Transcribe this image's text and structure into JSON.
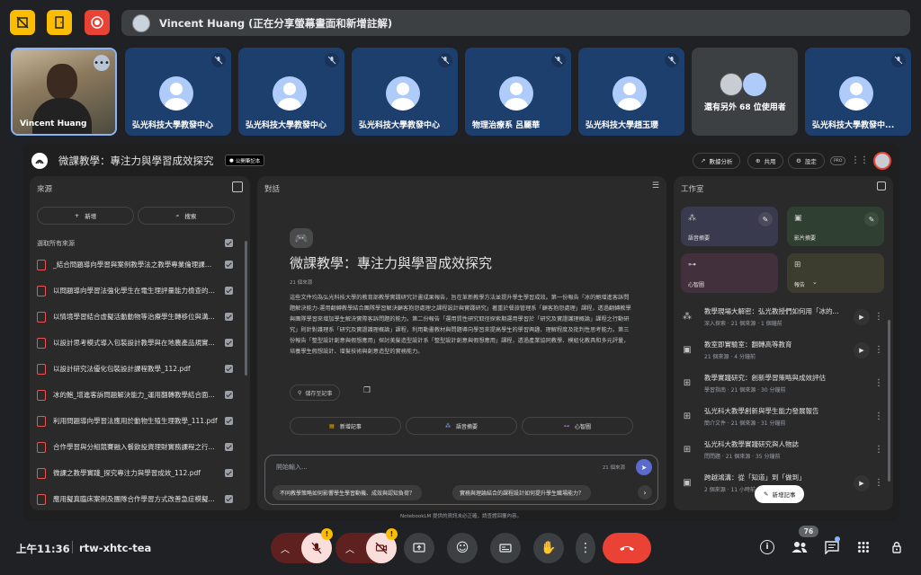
{
  "presenter_bar": {
    "text": "Vincent Huang (正在分享螢幕畫面和新增註解)"
  },
  "participants": [
    {
      "name": "Vincent Huang"
    },
    {
      "name": "弘光科技大學教發中心"
    },
    {
      "name": "弘光科技大學教發中心"
    },
    {
      "name": "弘光科技大學教發中心"
    },
    {
      "name": "物理治療系 呂麗華"
    },
    {
      "name": "弘光科技大學趙玉瓔"
    },
    {
      "name": "還有另外 68 位使用者"
    },
    {
      "name": "弘光科技大學教發中..."
    }
  ],
  "notebook": {
    "title": "微課教學：專注力與學習成效探究",
    "public_badge": "公開筆記本",
    "header_buttons": {
      "analytics": "數據分析",
      "share": "共用",
      "settings": "設定",
      "pro": "PRO"
    },
    "sources": {
      "title": "來源",
      "add": "新增",
      "search": "搜索",
      "select_all": "選取所有來源",
      "items": [
        "_結合問題導向學習與案例教學法之教學專業倫理課程...",
        "以問題導向學習法強化學生在電生理評量能力檢查的問題...",
        "以情境學習結合虛擬活動動物等治療學生轉移位與溝...",
        "以設計思考模式導入包裝設計教學與在地農產品規實...",
        "以設計研究法優化包裝設計課程教學_112.pdf",
        "冰的鮑_增進客訴問題解決能力_運用翻轉教學結合面...",
        "利用問題導向學習法應用於動物生殖生理教學_111.pdf",
        "合作學習與分組競賽融入餐飲投資理財實務課程之行...",
        "微課之教學實踐_探究專注力與學習成效_112.pdf",
        "應用擬真臨床案例及團隊合作學習方式改善急症模擬..."
      ]
    },
    "chat": {
      "title": "對話",
      "heading": "微課教學：專注力與學習成效探究",
      "source_count": "21 個來源",
      "summary": "這些文件均為弘光科技大學的教育部教學實踐研究計畫成果報告，旨在革新教學方法並提升學生學習成效。第一份報告「冰的鮑增進客訴問題解決能力-運用翻轉教學結合團隊學習解決顧客抱怨處理之課程設計與實踐研究」著重於餐旅管理系「顧客抱怨處理」課程，透過翻轉教學與團隊學習來增加學生解決實際客訴問題的能力。第二份報告「運用質性研究取徑探索期運用學習於「研究及實證護理概論」課程之行動研究」則針對護理系「研究及實證護理概論」課程，利用動畫教材與問題導向學習來提高學生的學習興趣、理解程度及批判性思考能力。第三份報告「整型設計創意與假想應用」探討美髮造型設計系「整型設計創意與假想應用」課程，透過產業協同教學、模組化教具和多元評量，培養學生假想設計、增髮技術與創意造型的實務能力。",
      "save_note": "儲存至記事",
      "actions": {
        "add_note": "新增記事",
        "audio_overview": "語音摘要",
        "mind_map": "心智圖"
      },
      "input_placeholder": "開始輸入...",
      "input_count": "21 個來源",
      "suggestions": [
        "不同教學策略如何影響學生學習動機、成效與認知負荷？",
        "實務與理論結合的課程設計如何提升學生職場能力？"
      ]
    },
    "studio": {
      "title": "工作室",
      "cards": {
        "audio": "語音摘要",
        "video": "影片摘要",
        "mindmap": "心智圖",
        "report": "報告"
      },
      "items": [
        {
          "title": "教學現場大解密：弘光教授們如何用「冰的...",
          "meta": "深入探索 · 21 個來源 · 1 個鐘前"
        },
        {
          "title": "教室即實驗室：翻轉高等教育",
          "meta": "21 個來源 · 4 分鐘前"
        },
        {
          "title": "教學實踐研究：創新學習策略與成效評估",
          "meta": "學習指南 · 21 個來源 · 30 分鐘前"
        },
        {
          "title": "弘光科大教學創新與學生能力發展報告",
          "meta": "簡介文件 · 21 個來源 · 31 分鐘前"
        },
        {
          "title": "弘光科大教學實踐研究與人物誌",
          "meta": "問問題 · 21 個來源 · 35 分鐘前"
        },
        {
          "title": "跨越鴻溝：從「知道」到「做到」",
          "meta": "2 個來源 · 11 小時前"
        }
      ],
      "add_note_button": "新增記事"
    },
    "footer": "NotebookLM 提供的資訊未必正確，請查證回覆內容。"
  },
  "bottom": {
    "time": "上午11:36",
    "meeting_code": "rtw-xhtc-tea",
    "participant_count": "76"
  },
  "colors": {
    "end_call": "#ea4335",
    "tile_bg": "#1d3f6e",
    "accent_blue": "#8ab4f8",
    "mic_off_bg": "#5f2120",
    "warn_yellow": "#fbbc04"
  }
}
